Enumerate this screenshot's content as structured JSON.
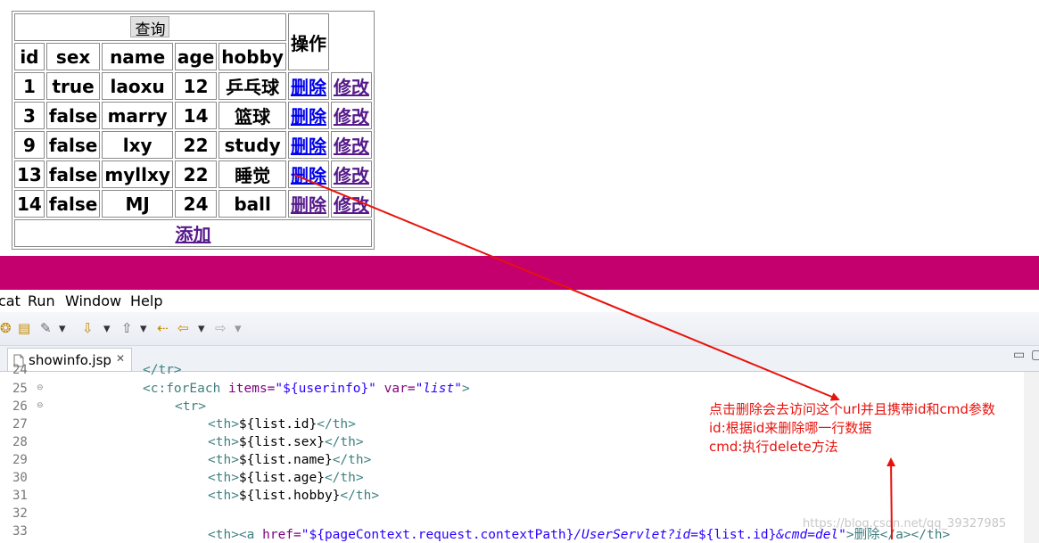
{
  "browser_table": {
    "query_button": "查询",
    "operation_header": "操作",
    "columns": [
      "id",
      "sex",
      "name",
      "age",
      "hobby"
    ],
    "rows": [
      [
        "1",
        "true",
        "laoxu",
        "12",
        "乒乓球"
      ],
      [
        "3",
        "false",
        "marry",
        "14",
        "篮球"
      ],
      [
        "9",
        "false",
        "lxy",
        "22",
        "study"
      ],
      [
        "13",
        "false",
        "myllxy",
        "22",
        "睡觉"
      ],
      [
        "14",
        "false",
        "MJ",
        "24",
        "ball"
      ]
    ],
    "delete_label": "删除",
    "edit_label": "修改",
    "add_label": "添加"
  },
  "ide": {
    "menu": [
      "cat",
      "Run",
      "Window",
      "Help"
    ],
    "tab_title": "showinfo.jsp",
    "tab_close": "✕",
    "line_numbers": [
      "24",
      "25",
      "26",
      "27",
      "28",
      "29",
      "30",
      "31",
      "32",
      "33"
    ],
    "code_lines": {
      "l24": "</tr>",
      "l25_tag": "<c:forEach ",
      "l25_attr1": "items=",
      "l25_val1": "\"${userinfo}\"",
      "l25_attr2": " var=",
      "l25_val2": "\"list\"",
      "l25_close": ">",
      "l26": "<tr>",
      "l27": [
        "<th>",
        "${list.id}",
        "</th>"
      ],
      "l28": [
        "<th>",
        "${list.sex}",
        "</th>"
      ],
      "l29": [
        "<th>",
        "${list.name}",
        "</th>"
      ],
      "l30": [
        "<th>",
        "${list.age}",
        "</th>"
      ],
      "l31": [
        "<th>",
        "${list.hobby}",
        "</th>"
      ],
      "l33_open": "<th><a ",
      "l33_attr": "href=",
      "l33_val1": "\"${pageContext.request.contextPath}",
      "l33_val2": "/UserServlet?id=",
      "l33_val3": "${list.id}",
      "l33_val4": "&cmd=del",
      "l33_val5": "\"",
      "l33_tail": ">删除</a></th>"
    }
  },
  "annotation": {
    "line1": "点击删除会去访问这个url并且携带id和cmd参数",
    "line2": "id:根据id来删除哪一行数据",
    "line3": "cmd:执行delete方法"
  },
  "watermark": "https://blog.csdn.net/qq_39327985",
  "colors": {
    "separator": "#c3006e",
    "arrow": "#e8120c",
    "link": "#0000ee",
    "visited_link": "#551a8b"
  }
}
